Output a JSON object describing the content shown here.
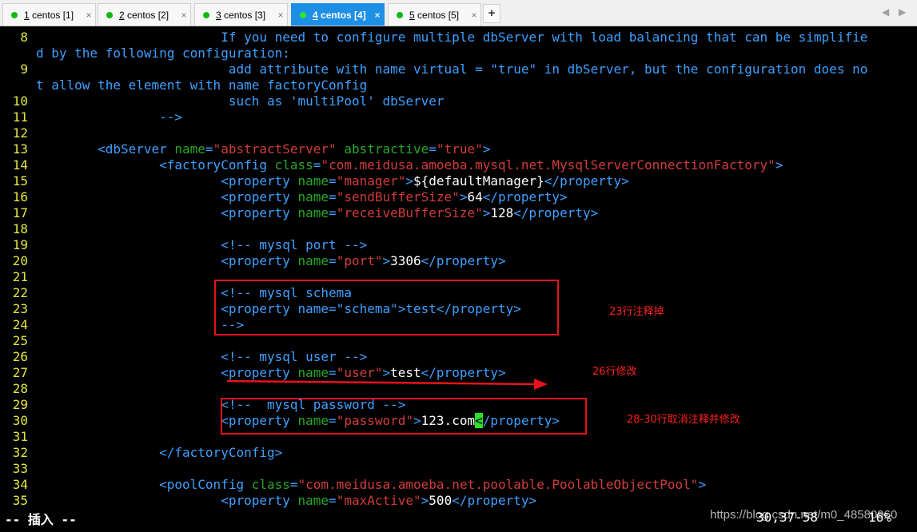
{
  "tabs": [
    {
      "num": "1",
      "label": " centos [1]",
      "active": false
    },
    {
      "num": "2",
      "label": " centos [2]",
      "active": false
    },
    {
      "num": "3",
      "label": " centos [3]",
      "active": false
    },
    {
      "num": "4",
      "label": " centos [4]",
      "active": true
    },
    {
      "num": "5",
      "label": " centos [5]",
      "active": false
    }
  ],
  "tab_close": "×",
  "add_tab": "+",
  "nav_prev": "◀",
  "nav_next": "▶",
  "colors": {
    "tab_active": "#1e8fe6",
    "session_dot": "#12b812",
    "comment": "#3ea0ff",
    "attr": "#27a827",
    "string": "#d23c3c",
    "line_number": "#e6e640",
    "annotation": "#e8121a"
  },
  "lines": [
    {
      "n": "8",
      "segs": [
        [
          "c-cm",
          "                        If you need to configure multiple dbServer with load balancing that can be simplifie"
        ]
      ]
    },
    {
      "n": "",
      "segs": [
        [
          "c-cm",
          "d by the following configuration:"
        ]
      ]
    },
    {
      "n": "9",
      "segs": [
        [
          "c-cm",
          "                         add attribute with name virtual = \"true\" in dbServer, but the configuration does no"
        ]
      ]
    },
    {
      "n": "",
      "segs": [
        [
          "c-cm",
          "t allow the element with name factoryConfig"
        ]
      ]
    },
    {
      "n": "10",
      "segs": [
        [
          "c-cm",
          "                         such as 'multiPool' dbServer"
        ]
      ]
    },
    {
      "n": "11",
      "segs": [
        [
          "c-cm",
          "                -->"
        ]
      ]
    },
    {
      "n": "12",
      "segs": []
    },
    {
      "n": "13",
      "segs": [
        [
          "c-txt",
          "        "
        ],
        [
          "c-tag",
          "<dbServer "
        ],
        [
          "c-attr",
          "name"
        ],
        [
          "c-tag",
          "="
        ],
        [
          "c-str",
          "\"abstractServer\""
        ],
        [
          "c-tag",
          " "
        ],
        [
          "c-attr",
          "abstractive"
        ],
        [
          "c-tag",
          "="
        ],
        [
          "c-str",
          "\"true\""
        ],
        [
          "c-tag",
          ">"
        ]
      ]
    },
    {
      "n": "14",
      "segs": [
        [
          "c-txt",
          "                "
        ],
        [
          "c-tag",
          "<factoryConfig "
        ],
        [
          "c-attr",
          "class"
        ],
        [
          "c-tag",
          "="
        ],
        [
          "c-str",
          "\"com.meidusa.amoeba.mysql.net.MysqlServerConnectionFactory\""
        ],
        [
          "c-tag",
          ">"
        ]
      ]
    },
    {
      "n": "15",
      "segs": [
        [
          "c-txt",
          "                        "
        ],
        [
          "c-tag",
          "<property "
        ],
        [
          "c-attr",
          "name"
        ],
        [
          "c-tag",
          "="
        ],
        [
          "c-str",
          "\"manager\""
        ],
        [
          "c-tag",
          ">"
        ],
        [
          "c-txt",
          "${defaultManager}"
        ],
        [
          "c-tag",
          "</property>"
        ]
      ]
    },
    {
      "n": "16",
      "segs": [
        [
          "c-txt",
          "                        "
        ],
        [
          "c-tag",
          "<property "
        ],
        [
          "c-attr",
          "name"
        ],
        [
          "c-tag",
          "="
        ],
        [
          "c-str",
          "\"sendBufferSize\""
        ],
        [
          "c-tag",
          ">"
        ],
        [
          "c-txt",
          "64"
        ],
        [
          "c-tag",
          "</property>"
        ]
      ]
    },
    {
      "n": "17",
      "segs": [
        [
          "c-txt",
          "                        "
        ],
        [
          "c-tag",
          "<property "
        ],
        [
          "c-attr",
          "name"
        ],
        [
          "c-tag",
          "="
        ],
        [
          "c-str",
          "\"receiveBufferSize\""
        ],
        [
          "c-tag",
          ">"
        ],
        [
          "c-txt",
          "128"
        ],
        [
          "c-tag",
          "</property>"
        ]
      ]
    },
    {
      "n": "18",
      "segs": []
    },
    {
      "n": "19",
      "segs": [
        [
          "c-cm",
          "                        <!-- mysql port -->"
        ]
      ]
    },
    {
      "n": "20",
      "segs": [
        [
          "c-txt",
          "                        "
        ],
        [
          "c-tag",
          "<property "
        ],
        [
          "c-attr",
          "name"
        ],
        [
          "c-tag",
          "="
        ],
        [
          "c-str",
          "\"port\""
        ],
        [
          "c-tag",
          ">"
        ],
        [
          "c-txt",
          "3306"
        ],
        [
          "c-tag",
          "</property>"
        ]
      ]
    },
    {
      "n": "21",
      "segs": []
    },
    {
      "n": "22",
      "segs": [
        [
          "c-cm",
          "                        <!-- mysql schema"
        ]
      ]
    },
    {
      "n": "23",
      "segs": [
        [
          "c-cm",
          "                        <property name=\"schema\">test</property>"
        ]
      ]
    },
    {
      "n": "24",
      "segs": [
        [
          "c-cm",
          "                        -->"
        ]
      ]
    },
    {
      "n": "25",
      "segs": []
    },
    {
      "n": "26",
      "segs": [
        [
          "c-cm",
          "                        <!-- mysql user -->"
        ]
      ]
    },
    {
      "n": "27",
      "segs": [
        [
          "c-txt",
          "                        "
        ],
        [
          "c-tag",
          "<property "
        ],
        [
          "c-attr",
          "name"
        ],
        [
          "c-tag",
          "="
        ],
        [
          "c-str",
          "\"user\""
        ],
        [
          "c-tag",
          ">"
        ],
        [
          "c-txt",
          "test"
        ],
        [
          "c-tag",
          "</property>"
        ]
      ]
    },
    {
      "n": "28",
      "segs": []
    },
    {
      "n": "29",
      "segs": [
        [
          "c-cm",
          "                        <!--  mysql password -->"
        ]
      ]
    },
    {
      "n": "30",
      "segs": [
        [
          "c-txt",
          "                        "
        ],
        [
          "c-tag",
          "<property "
        ],
        [
          "c-attr",
          "name"
        ],
        [
          "c-tag",
          "="
        ],
        [
          "c-str",
          "\"password\""
        ],
        [
          "c-tag",
          ">"
        ],
        [
          "c-txt",
          "123.com"
        ],
        [
          "cursor",
          "<"
        ],
        [
          "c-tag",
          "/property>"
        ]
      ]
    },
    {
      "n": "31",
      "segs": []
    },
    {
      "n": "32",
      "segs": [
        [
          "c-txt",
          "                "
        ],
        [
          "c-tag",
          "</factoryConfig>"
        ]
      ]
    },
    {
      "n": "33",
      "segs": []
    },
    {
      "n": "34",
      "segs": [
        [
          "c-txt",
          "                "
        ],
        [
          "c-tag",
          "<poolConfig "
        ],
        [
          "c-attr",
          "class"
        ],
        [
          "c-tag",
          "="
        ],
        [
          "c-str",
          "\"com.meidusa.amoeba.net.poolable.PoolableObjectPool\""
        ],
        [
          "c-tag",
          ">"
        ]
      ]
    },
    {
      "n": "35",
      "segs": [
        [
          "c-txt",
          "                        "
        ],
        [
          "c-tag",
          "<property "
        ],
        [
          "c-attr",
          "name"
        ],
        [
          "c-tag",
          "="
        ],
        [
          "c-str",
          "\"maxActive\""
        ],
        [
          "c-tag",
          ">"
        ],
        [
          "c-txt",
          "500"
        ],
        [
          "c-tag",
          "</property>"
        ]
      ]
    }
  ],
  "status": {
    "mode": "-- 插入 --",
    "position": "30,37-58",
    "percent": "16%"
  },
  "watermark": "https://blog.csdn.net/m0_48580960",
  "annotations": {
    "note1": "23行注释掉",
    "note2": "26行修改",
    "note3": "28-30行取消注释并修改"
  }
}
